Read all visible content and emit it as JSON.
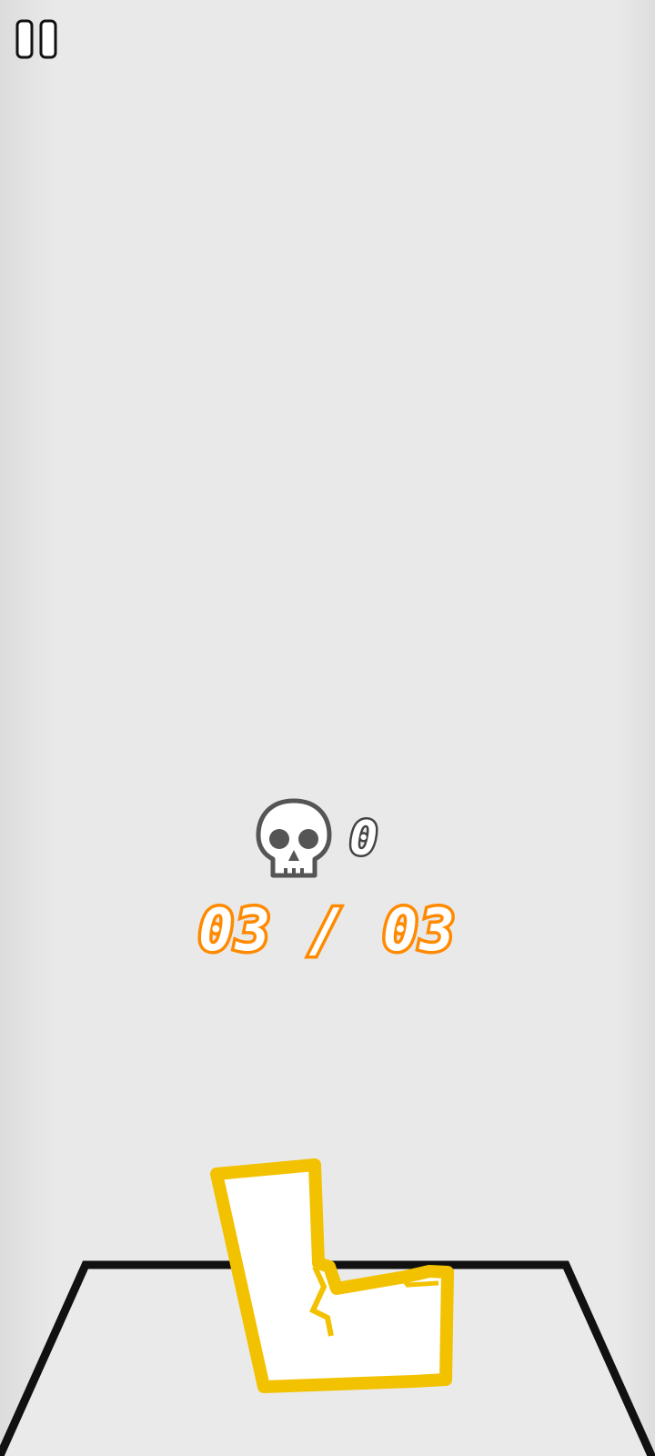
{
  "hud": {
    "death_count": "0",
    "level_progress": "03 / 03"
  },
  "icons": {
    "pause": "pause-icon",
    "skull": "skull-icon"
  },
  "colors": {
    "background": "#e9e9e9",
    "progress_outline": "#ff8a00",
    "piece_outline": "#f2c200",
    "platform": "#111111",
    "skull": "#555555"
  }
}
